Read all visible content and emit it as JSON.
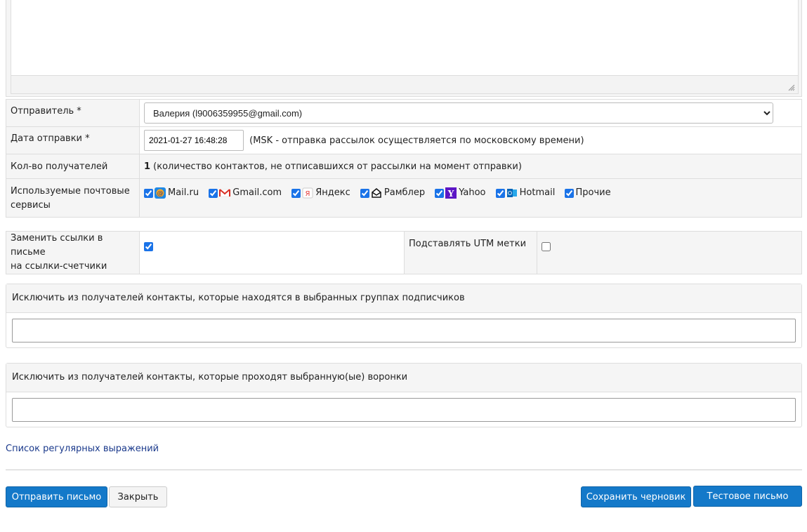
{
  "form": {
    "sender": {
      "label": "Отправитель *",
      "value": "Валерия (l9006359955@gmail.com)"
    },
    "send_date": {
      "label": "Дата отправки *",
      "value": "2021-01-27 16:48:28",
      "note": "(MSK - отправка рассылок осуществляется по московскому времени)"
    },
    "recipients": {
      "label": "Кол-во получателей",
      "count": "1",
      "note": " (количество контактов, не отписавшихся от рассылки на момент отправки)"
    },
    "services": {
      "label_line1": "Используемые почтовые",
      "label_line2": "сервисы",
      "items": [
        {
          "name": "Mail.ru",
          "checked": true,
          "icon": "mailru-icon"
        },
        {
          "name": "Gmail.com",
          "checked": true,
          "icon": "gmail-icon"
        },
        {
          "name": "Яндекс",
          "checked": true,
          "icon": "yandex-icon"
        },
        {
          "name": "Рамблер",
          "checked": true,
          "icon": "rambler-icon"
        },
        {
          "name": "Yahoo",
          "checked": true,
          "icon": "yahoo-icon"
        },
        {
          "name": "Hotmail",
          "checked": true,
          "icon": "hotmail-icon"
        },
        {
          "name": "Прочие",
          "checked": true,
          "icon": ""
        }
      ]
    },
    "replace_links": {
      "label_line1": "Заменить ссылки в письме",
      "label_line2": "на ссылки-счетчики",
      "checked": true
    },
    "utm": {
      "label": "Подставлять UTM метки",
      "checked": false
    },
    "exclude_groups": {
      "label": "Исключить из получателей контакты, которые находятся в выбранных группах подписчиков",
      "value": ""
    },
    "exclude_funnels": {
      "label": "Исключить из получателей контакты, которые проходят выбранную(ые) воронки",
      "value": ""
    }
  },
  "regex_link": "Список регулярных выражений",
  "buttons": {
    "send": "Отправить письмо",
    "close": "Закрыть",
    "draft": "Сохранить черновик",
    "test": "Тестовое письмо"
  },
  "colors": {
    "primary": "#1479c9",
    "link": "#1b3a8c",
    "label_bg": "#f5f5f5"
  }
}
